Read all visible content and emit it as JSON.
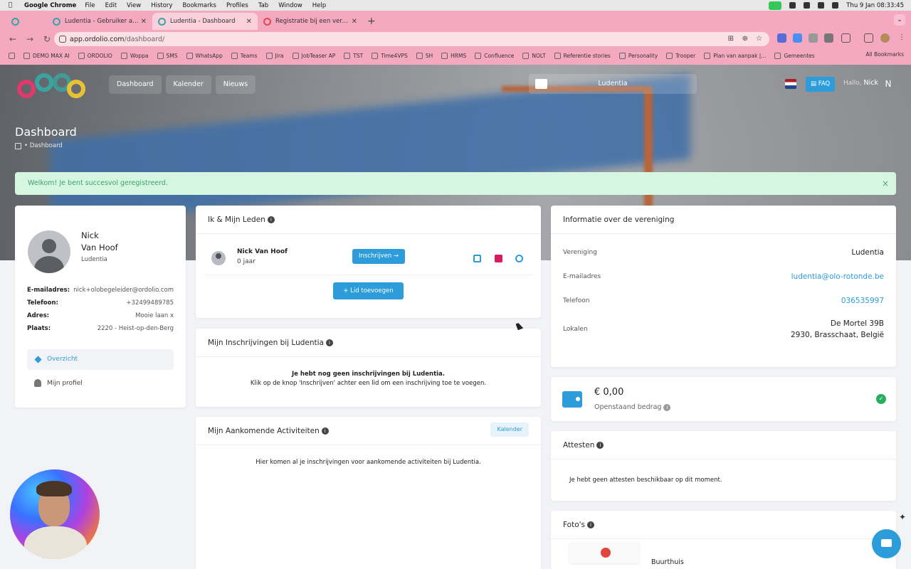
{
  "os_menubar": {
    "app": "Google Chrome",
    "menus": [
      "File",
      "Edit",
      "View",
      "History",
      "Bookmarks",
      "Profiles",
      "Tab",
      "Window",
      "Help"
    ],
    "clock": "Thu 9 Jan  08:33:45"
  },
  "browser": {
    "tabs": [
      {
        "title": "Ludentia - Gebruiker activeren"
      },
      {
        "title": "Ludentia - Dashboard"
      },
      {
        "title": "Registratie bij een vereniging"
      }
    ],
    "url_host": "app.ordolio.com",
    "url_path": "/dashboard/",
    "bookmarks": [
      "DEMO MAX AI",
      "ORDOLIO",
      "Woppa",
      "SMS",
      "WhatsApp",
      "Teams",
      "Jira",
      "JobTeaser AP",
      "TST",
      "Time4VPS",
      "SH",
      "HRMS",
      "Confluence",
      "NOLT",
      "Referentie stories",
      "Personality",
      "Trooper",
      "Plan van aanpak |...",
      "Gemeentes"
    ],
    "all_bookmarks": "All Bookmarks"
  },
  "header": {
    "nav": [
      "Dashboard",
      "Kalender",
      "Nieuws"
    ],
    "association": "Ludentia",
    "faq": "FAQ",
    "hello": "Hallo,",
    "user": "Nick",
    "avatar_initial": "N"
  },
  "page": {
    "title": "Dashboard",
    "breadcrumb": "• Dashboard",
    "alert": "Welkom! Je bent succesvol geregistreerd."
  },
  "profile": {
    "first_name": "Nick",
    "last_name": "Van Hoof",
    "club": "Ludentia",
    "fields": [
      {
        "k": "E-mailadres:",
        "v": "nick+olobegeleider@ordolio.com"
      },
      {
        "k": "Telefoon:",
        "v": "+32499489785"
      },
      {
        "k": "Adres:",
        "v": "Mooie laan x"
      },
      {
        "k": "Plaats:",
        "v": "2220 - Heist-op-den-Berg"
      }
    ],
    "menu_overview": "Overzicht",
    "menu_profile": "Mijn profiel"
  },
  "members": {
    "title": "Ik & Mijn Leden",
    "name": "Nick Van Hoof",
    "age": "0 jaar",
    "register": "Inschrijven →",
    "add": "+ Lid toevoegen"
  },
  "registrations": {
    "title": "Mijn Inschrijvingen bij Ludentia",
    "empty_bold": "Je hebt nog geen inschrijvingen bij Ludentia.",
    "empty_text": "Klik op de knop 'Inschrijven' achter een lid om een inschrijving toe te voegen."
  },
  "activities": {
    "title": "Mijn Aankomende Activiteiten",
    "calendar": "Kalender",
    "empty": "Hier komen al je inschrijvingen voor aankomende activiteiten bij Ludentia."
  },
  "assoc_info": {
    "title": "Informatie over de vereniging",
    "rows": [
      {
        "k": "Vereniging",
        "v": "Ludentia"
      },
      {
        "k": "E-mailadres",
        "v": "ludentia@olo-rotonde.be"
      },
      {
        "k": "Telefoon",
        "v": "036535997"
      },
      {
        "k": "Lokalen",
        "v": "De Mortel 39B",
        "v2": "2930, Brasschaat, België"
      }
    ]
  },
  "balance": {
    "amount": "€ 0,00",
    "label": "Openstaand bedrag"
  },
  "certificates": {
    "title": "Attesten",
    "empty": "Je hebt geen attesten beschikbaar op dit moment."
  },
  "photos": {
    "title": "Foto's",
    "album": "Buurthuis"
  },
  "colors": {
    "primary": "#2d9cdb",
    "success_bg": "#d6f6e2",
    "success_text": "#3aa26a",
    "chrome": "#f5a9c1"
  }
}
